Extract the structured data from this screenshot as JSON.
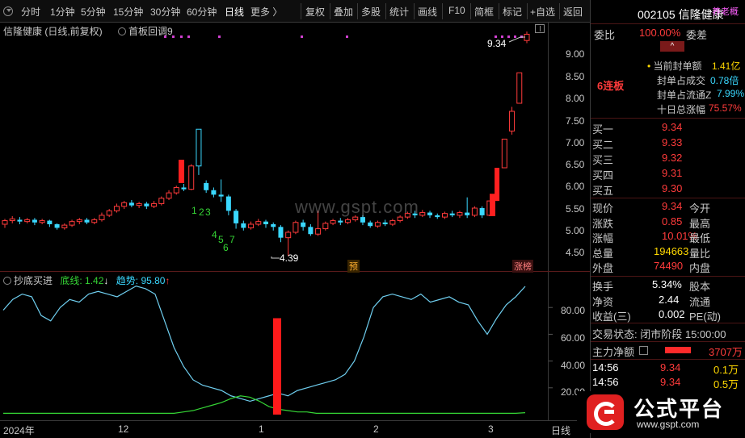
{
  "toolbar": {
    "items": [
      "分时",
      "1分钟",
      "5分钟",
      "15分钟",
      "30分钟",
      "60分钟",
      "日线",
      "更多 〉"
    ],
    "active_index": 6,
    "tools": [
      "复权",
      "叠加",
      "多股",
      "统计",
      "画线",
      "F10",
      "简框",
      "标记",
      "+自选",
      "返回"
    ]
  },
  "chart": {
    "header": "信隆健康 (日线,前复权)",
    "subtitle": "首板回调9",
    "high_label": "9.34",
    "low_label": "4.39",
    "signal_labels": [
      "1",
      "2",
      "3",
      "4",
      "5",
      "7",
      "6"
    ],
    "tag_yu": "预",
    "tag_zhangbang": "涨榜",
    "y_ticks": [
      "9.00",
      "8.50",
      "8.00",
      "7.50",
      "7.00",
      "6.50",
      "6.00",
      "5.50",
      "5.00",
      "4.50"
    ]
  },
  "indicator": {
    "name": "抄底买进",
    "line1_label": "底线:",
    "line1_value": "1.42",
    "line2_label": "趋势:",
    "line2_value": "95.80",
    "y_ticks": [
      "80.00",
      "60.00",
      "40.00",
      "20.00"
    ]
  },
  "x_axis": {
    "labels": [
      "2024年",
      "12",
      "1",
      "2",
      "3"
    ],
    "period": "日线"
  },
  "watermark": "www.gspt.com",
  "brand": {
    "name": "公式平台",
    "url": "www.gspt.com"
  },
  "quote": {
    "code_name": "002105 信隆健康",
    "weibi_label": "委比",
    "weibi_value": "100.00%",
    "weicha_label": "委差",
    "top_right": "养老概",
    "streak": "6连板",
    "seal": [
      {
        "label": "当前封单额",
        "value": "1.41亿"
      },
      {
        "label": "封单占成交",
        "value": "0.78倍"
      },
      {
        "label": "封单占流通Z",
        "value": "7.99%"
      },
      {
        "label": "十日总涨幅",
        "value": "75.57%"
      }
    ],
    "bids": [
      {
        "label": "买一",
        "price": "9.34"
      },
      {
        "label": "买二",
        "price": "9.33"
      },
      {
        "label": "买三",
        "price": "9.32"
      },
      {
        "label": "买四",
        "price": "9.31"
      },
      {
        "label": "买五",
        "price": "9.30"
      }
    ],
    "stats": [
      {
        "l1": "现价",
        "v1": "9.34",
        "l2": "今开",
        "v2": ""
      },
      {
        "l1": "涨跌",
        "v1": "0.85",
        "l2": "最高",
        "v2": ""
      },
      {
        "l1": "涨幅",
        "v1": "10.01%",
        "l2": "最低",
        "v2": ""
      },
      {
        "l1": "总量",
        "v1": "194663",
        "l2": "量比",
        "v2": ""
      },
      {
        "l1": "外盘",
        "v1": "74490",
        "l2": "内盘",
        "v2": ""
      }
    ],
    "stats2": [
      {
        "l1": "换手",
        "v1": "5.34%",
        "l2": "股本"
      },
      {
        "l1": "净资",
        "v1": "2.44",
        "l2": "流通"
      },
      {
        "l1": "收益(三)",
        "v1": "0.002",
        "l2": "PE(动)"
      }
    ],
    "status": "交易状态: 闭市阶段 15:00:00",
    "main_flow_label": "主力净额",
    "main_flow_value": "3707万",
    "ticks": [
      {
        "time": "14:56",
        "price": "9.34",
        "vol": "0.1万"
      },
      {
        "time": "14:56",
        "price": "9.34",
        "vol": "0.5万"
      }
    ]
  },
  "colors": {
    "up": "#ff3b3b",
    "down": "#3ad8ff",
    "line_trend": "#6fcff0",
    "line_bottom": "#35d535",
    "accent": "#ff3b3b"
  }
}
